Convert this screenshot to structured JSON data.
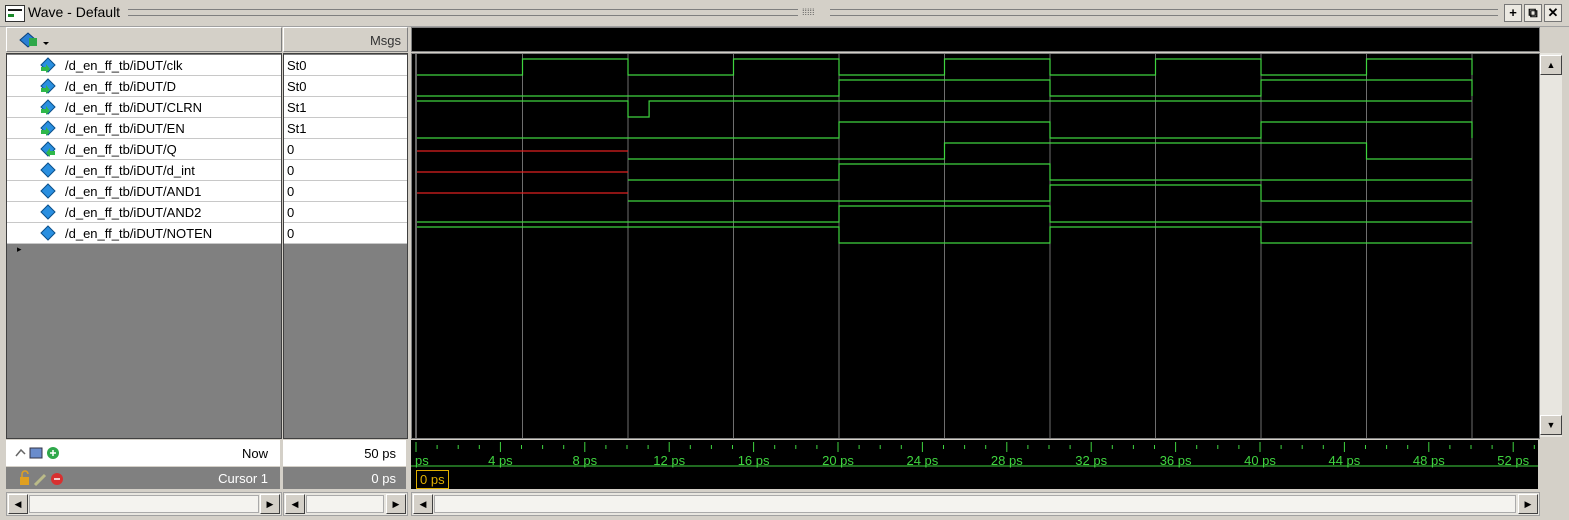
{
  "window": {
    "title": "Wave - Default",
    "buttons": [
      "+",
      "⧉",
      "✕"
    ]
  },
  "header": {
    "msgs_label": "Msgs"
  },
  "signals": [
    {
      "name": "/d_en_ff_tb/iDUT/clk",
      "value": "St0",
      "kind": "input"
    },
    {
      "name": "/d_en_ff_tb/iDUT/D",
      "value": "St0",
      "kind": "input"
    },
    {
      "name": "/d_en_ff_tb/iDUT/CLRN",
      "value": "St1",
      "kind": "input"
    },
    {
      "name": "/d_en_ff_tb/iDUT/EN",
      "value": "St1",
      "kind": "input"
    },
    {
      "name": "/d_en_ff_tb/iDUT/Q",
      "value": "0",
      "kind": "output"
    },
    {
      "name": "/d_en_ff_tb/iDUT/d_int",
      "value": "0",
      "kind": "internal"
    },
    {
      "name": "/d_en_ff_tb/iDUT/AND1",
      "value": "0",
      "kind": "internal"
    },
    {
      "name": "/d_en_ff_tb/iDUT/AND2",
      "value": "0",
      "kind": "internal"
    },
    {
      "name": "/d_en_ff_tb/iDUT/NOTEN",
      "value": "0",
      "kind": "internal"
    }
  ],
  "waveforms": {
    "t_start": 0,
    "t_end": 50,
    "clk": [
      [
        0,
        0
      ],
      [
        5,
        1
      ],
      [
        10,
        0
      ],
      [
        15,
        1
      ],
      [
        20,
        0
      ],
      [
        25,
        1
      ],
      [
        30,
        0
      ],
      [
        35,
        1
      ],
      [
        40,
        0
      ],
      [
        45,
        1
      ],
      [
        50,
        0
      ]
    ],
    "D": [
      [
        0,
        0
      ],
      [
        20,
        1
      ],
      [
        30,
        0
      ],
      [
        40,
        1
      ],
      [
        50,
        0
      ]
    ],
    "CLRN": [
      [
        0,
        1
      ],
      [
        10,
        0
      ],
      [
        11,
        1
      ]
    ],
    "EN": [
      [
        0,
        0
      ],
      [
        20,
        1
      ],
      [
        30,
        0
      ],
      [
        40,
        1
      ],
      [
        50,
        0
      ]
    ],
    "Q": [
      [
        0,
        "x"
      ],
      [
        10,
        0
      ],
      [
        25,
        1
      ],
      [
        45,
        0
      ]
    ],
    "d_int": [
      [
        0,
        "x"
      ],
      [
        10,
        0
      ],
      [
        20,
        1
      ],
      [
        30,
        0
      ]
    ],
    "AND1": [
      [
        0,
        "x"
      ],
      [
        10,
        0
      ],
      [
        30,
        1
      ],
      [
        40,
        0
      ]
    ],
    "AND2": [
      [
        0,
        0
      ],
      [
        20,
        1
      ],
      [
        30,
        0
      ]
    ],
    "NOTEN": [
      [
        0,
        1
      ],
      [
        20,
        0
      ],
      [
        30,
        1
      ],
      [
        40,
        0
      ]
    ],
    "grid_times": [
      5,
      10,
      15,
      20,
      25,
      30,
      35,
      40,
      45,
      50
    ],
    "colors": {
      "wave": "#3fd43f",
      "unknown": "#e02020",
      "grid": "#6e6e6e",
      "tick": "#3fd43f"
    }
  },
  "status": {
    "now_label": "Now",
    "now_value": "50 ps",
    "cursor_label": "Cursor 1",
    "cursor_value": "0 ps",
    "cursor_tag": "0 ps"
  },
  "timeline": {
    "labels": [
      {
        "t": 0,
        "text": "ps"
      },
      {
        "t": 4,
        "text": "4 ps"
      },
      {
        "t": 8,
        "text": "8 ps"
      },
      {
        "t": 12,
        "text": "12 ps"
      },
      {
        "t": 16,
        "text": "16 ps"
      },
      {
        "t": 20,
        "text": "20 ps"
      },
      {
        "t": 24,
        "text": "24 ps"
      },
      {
        "t": 28,
        "text": "28 ps"
      },
      {
        "t": 32,
        "text": "32 ps"
      },
      {
        "t": 36,
        "text": "36 ps"
      },
      {
        "t": 40,
        "text": "40 ps"
      },
      {
        "t": 44,
        "text": "44 ps"
      },
      {
        "t": 48,
        "text": "48 ps"
      },
      {
        "t": 52,
        "text": "52 ps"
      }
    ]
  }
}
